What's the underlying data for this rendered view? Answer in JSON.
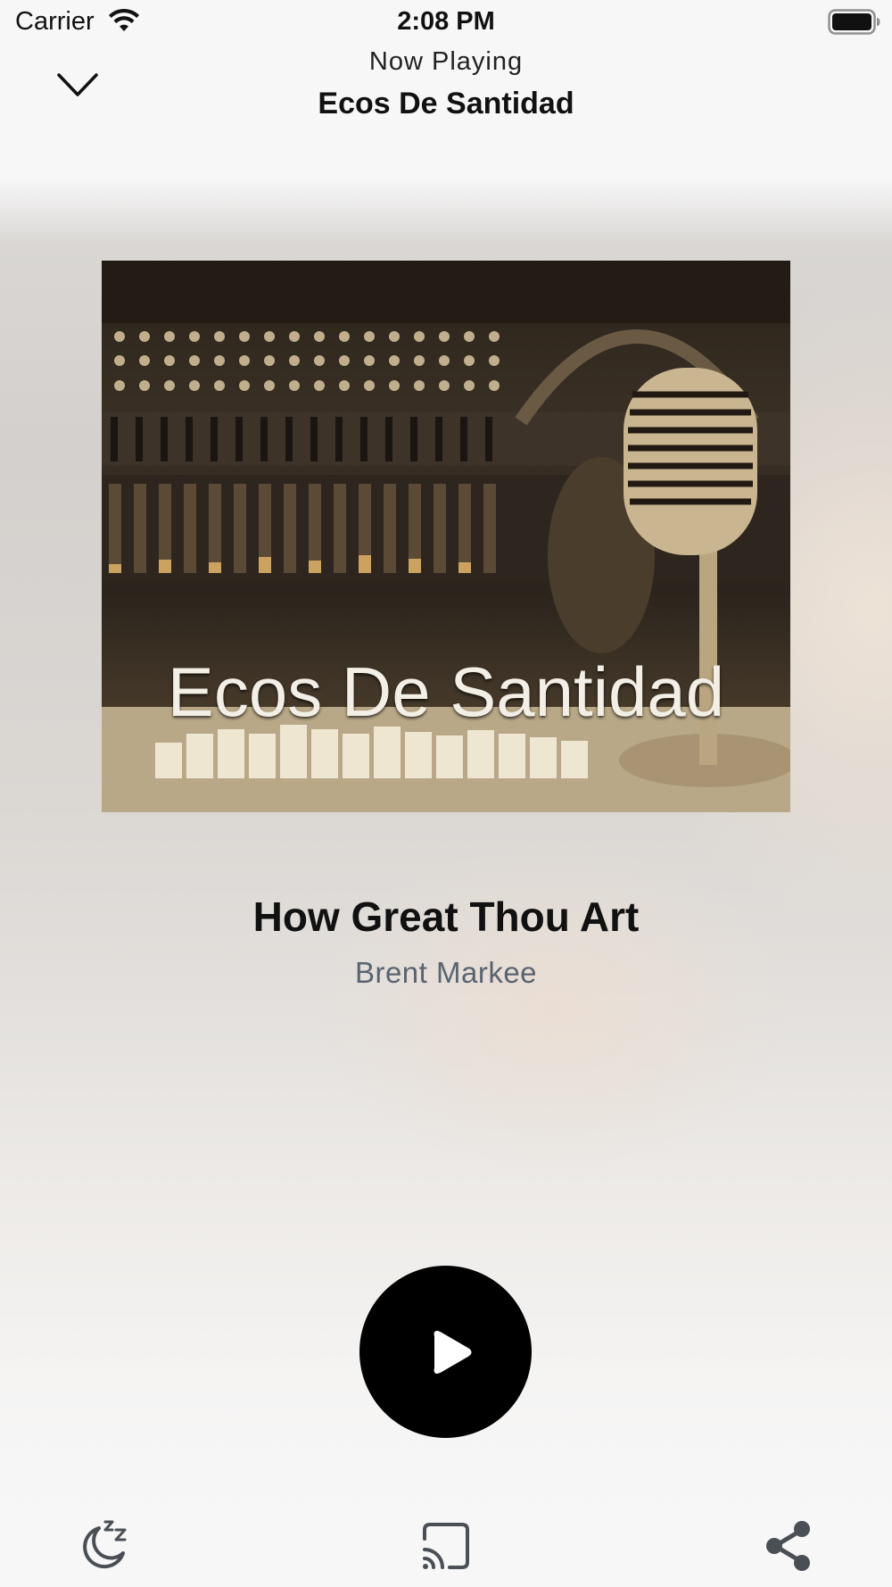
{
  "status_bar": {
    "carrier": "Carrier",
    "time": "2:08 PM",
    "icons": [
      "wifi-icon",
      "battery-icon"
    ]
  },
  "header": {
    "subtitle": "Now Playing",
    "title": "Ecos De Santidad",
    "collapse_icon": "chevron-down-icon"
  },
  "artwork": {
    "text": "Ecos De Santidad"
  },
  "track": {
    "title": "How Great Thou Art",
    "artist": "Brent Markee"
  },
  "player": {
    "play_icon": "play-icon"
  },
  "toolbar": {
    "items": [
      "sleep-timer-icon",
      "cast-icon",
      "share-icon"
    ]
  },
  "colors": {
    "accent": "#000000",
    "artist_text": "#5a6470",
    "icon_gray": "#4a4f55"
  }
}
